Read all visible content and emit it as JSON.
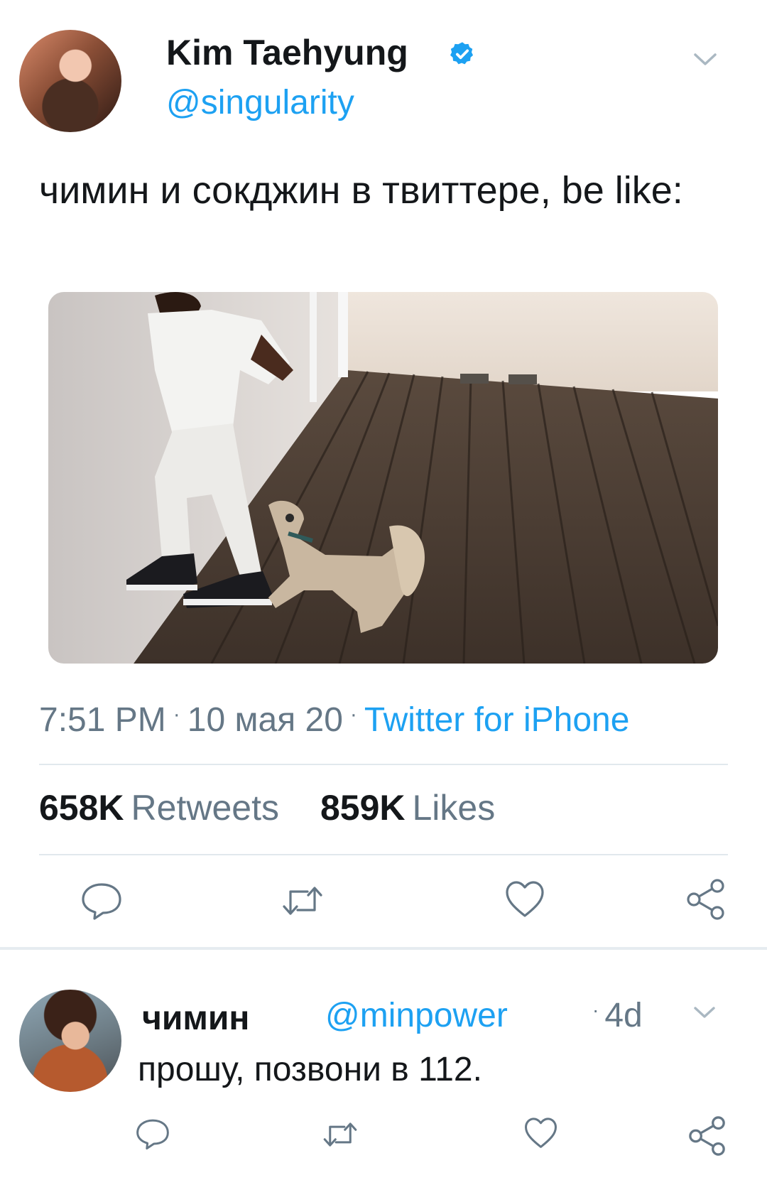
{
  "tweet": {
    "author_name": "Kim Taehyung",
    "author_handle": "@singularity",
    "verified": true,
    "text": "чимин и сокджин в твиттере, be like:",
    "time": "7:51 PM",
    "date": "10 мая 20",
    "source": "Twitter for iPhone",
    "retweets_count": "658K",
    "retweets_label": "Retweets",
    "likes_count": "859K",
    "likes_label": "Likes",
    "actions": [
      "reply-icon",
      "retweet-icon",
      "heart-icon",
      "share-icon"
    ]
  },
  "reply": {
    "author_name": "чимин",
    "author_handle": "@minpower",
    "age": "4d",
    "text": "прошу, позвони в 112.",
    "actions": [
      "reply-icon",
      "retweet-icon",
      "heart-icon",
      "share-icon"
    ]
  },
  "colors": {
    "accent": "#1da1f2",
    "secondary_text": "#657786",
    "divider": "#e1e8ed"
  }
}
